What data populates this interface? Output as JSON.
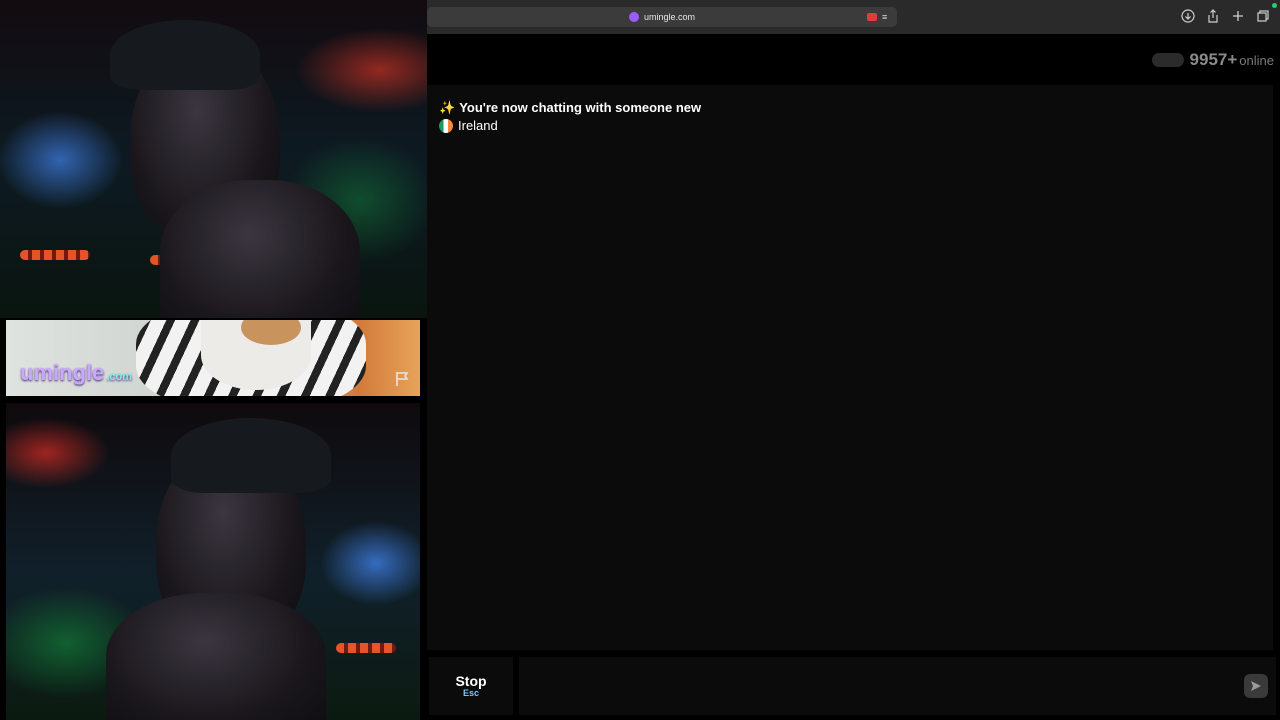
{
  "browser": {
    "url": "umingle.com"
  },
  "brand": {
    "logo_text": "umingle",
    "logo_suffix": ".com"
  },
  "stats": {
    "online_count": "9957+",
    "online_label": "online"
  },
  "chat": {
    "messages": [
      {
        "icon": "sparkles-icon",
        "text": "You're now chatting with someone new"
      },
      {
        "icon": "ireland-flag-icon",
        "text": "Ireland"
      }
    ]
  },
  "controls": {
    "stop_label": "Stop",
    "stop_key": "Esc",
    "message_placeholder": ""
  },
  "colors": {
    "accent": "#9a5cff",
    "record": "#e23b3b",
    "online_dot": "#2ecc71"
  }
}
